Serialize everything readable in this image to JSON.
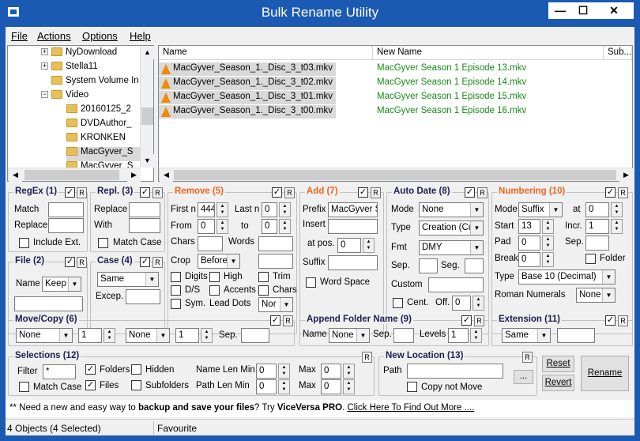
{
  "window": {
    "title": "Bulk Rename Utility",
    "minimize": "—",
    "maximize": "☐",
    "close": "✕"
  },
  "menu": [
    "File",
    "Actions",
    "Options",
    "Help"
  ],
  "tree": [
    "NyDownload",
    "Stella11",
    "System Volume In",
    "Video",
    "20160125_2",
    "DVDAuthor_",
    "KRONKEN",
    "MacGyver_S",
    "MacGyver_S"
  ],
  "filelist": {
    "headers": [
      "Name",
      "New Name",
      "Sub..."
    ],
    "rows": [
      {
        "name": "MacGyver_Season_1._Disc_3_t03.mkv",
        "new_name": "MacGyver Season 1 Episode 13.mkv"
      },
      {
        "name": "MacGyver_Season_1._Disc_3_t02.mkv",
        "new_name": "MacGyver Season 1 Episode 14.mkv"
      },
      {
        "name": "MacGyver_Season_1._Disc_3_t01.mkv",
        "new_name": "MacGyver Season 1 Episode 15.mkv"
      },
      {
        "name": "MacGyver_Season_1._Disc_3_t00.mkv",
        "new_name": "MacGyver Season 1 Episode 16.mkv"
      }
    ]
  },
  "regex": {
    "title": "RegEx (1)",
    "match": "Match",
    "replace": "Replace",
    "include_ext": "Include Ext."
  },
  "repl": {
    "title": "Repl. (3)",
    "replace": "Replace",
    "with": "With",
    "match_case": "Match Case"
  },
  "remove": {
    "title": "Remove (5)",
    "first_n": "First n",
    "first_n_val": "444",
    "last_n": "Last n",
    "last_n_val": "0",
    "from": "From",
    "from_val": "0",
    "to": "to",
    "to_val": "0",
    "chars": "Chars",
    "words": "Words",
    "crop": "Crop",
    "crop_val": "Before",
    "digits": "Digits",
    "high": "High",
    "trim": "Trim",
    "ds": "D/S",
    "accents": "Accents",
    "chars2": "Chars",
    "sym": "Sym.",
    "lead_dots": "Lead Dots",
    "lead_dots_val": "Nor"
  },
  "add": {
    "title": "Add (7)",
    "prefix": "Prefix",
    "prefix_val": "MacGyver S",
    "insert": "Insert",
    "at_pos": "at pos.",
    "at_pos_val": "0",
    "suffix": "Suffix",
    "word_space": "Word Space"
  },
  "autodate": {
    "title": "Auto Date (8)",
    "mode": "Mode",
    "mode_val": "None",
    "type": "Type",
    "type_val": "Creation (Cur",
    "fmt": "Fmt",
    "fmt_val": "DMY",
    "sep": "Sep.",
    "seg": "Seg.",
    "custom": "Custom",
    "cent": "Cent.",
    "off": "Off.",
    "off_val": "0"
  },
  "numbering": {
    "title": "Numbering (10)",
    "mode": "Mode",
    "mode_val": "Suffix",
    "at": "at",
    "at_val": "0",
    "start": "Start",
    "start_val": "13",
    "incr": "Incr.",
    "incr_val": "1",
    "pad": "Pad",
    "pad_val": "0",
    "sep": "Sep.",
    "brk": "Break",
    "break_val": "0",
    "folder": "Folder",
    "type": "Type",
    "type_val": "Base 10 (Decimal)",
    "roman": "Roman Numerals",
    "roman_val": "None"
  },
  "file": {
    "title": "File (2)",
    "name": "Name",
    "name_val": "Keep"
  },
  "case": {
    "title": "Case (4)",
    "case_val": "Same",
    "excep": "Excep."
  },
  "movecopy": {
    "title": "Move/Copy (6)",
    "dd1": "None",
    "val1": "1",
    "dd2": "None",
    "val2": "1",
    "sep": "Sep."
  },
  "appendfolder": {
    "title": "Append Folder Name (9)",
    "name": "Name",
    "name_val": "None",
    "sep": "Sep.",
    "levels": "Levels",
    "levels_val": "1"
  },
  "extension": {
    "title": "Extension (11)",
    "val": "Same"
  },
  "selections": {
    "title": "Selections (12)",
    "filter": "Filter",
    "filter_val": "*",
    "folders": "Folders",
    "hidden": "Hidden",
    "name_len_min": "Name Len Min",
    "name_len_min_val": "0",
    "max": "Max",
    "name_len_max_val": "0",
    "match_case": "Match Case",
    "files": "Files",
    "subfolders": "Subfolders",
    "path_len_min": "Path Len Min",
    "path_len_min_val": "0",
    "path_len_max_val": "0"
  },
  "newlocation": {
    "title": "New Location (13)",
    "path": "Path",
    "browse": "...",
    "copy_not_move": "Copy not Move"
  },
  "buttons": {
    "reset": "Reset",
    "revert": "Revert",
    "rename": "Rename"
  },
  "promo": {
    "prefix": "** Need a new and easy way to ",
    "bold1": "backup and save your files",
    "mid": "? Try ",
    "bold2": "ViceVersa PRO",
    "dot": ". ",
    "link": "Click Here To Find Out More ...."
  },
  "status": {
    "objects": "4 Objects (4 Selected)",
    "favourite": "Favourite"
  },
  "icons": [
    "app-icon",
    "folder-icon",
    "vlc-cone-icon",
    "checkbox",
    "spinner-arrows",
    "dropdown-arrow"
  ],
  "colors": {
    "titlebar": "#1b5ab3",
    "orange": "#f0641e",
    "green": "#178a17",
    "navy": "#1e1e50"
  }
}
